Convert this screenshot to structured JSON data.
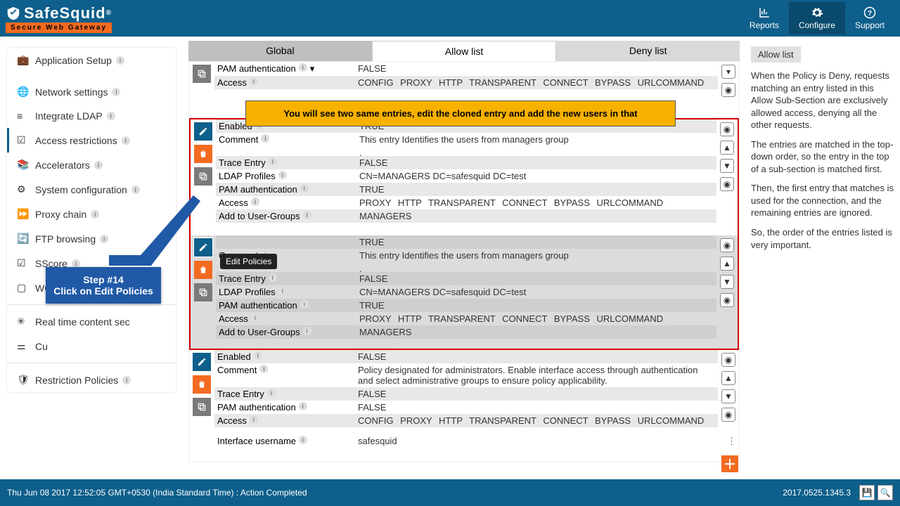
{
  "brand": {
    "name": "SafeSquid",
    "reg": "®",
    "tagline": "Secure Web Gateway"
  },
  "topbar": {
    "reports": "Reports",
    "configure": "Configure",
    "support": "Support"
  },
  "sidebar": {
    "items": [
      {
        "label": "Application Setup",
        "icon": "briefcase"
      },
      {
        "label": "Network settings",
        "icon": "globe"
      },
      {
        "label": "Integrate LDAP",
        "icon": "list"
      },
      {
        "label": "Access restrictions",
        "icon": "check-square",
        "selected": true
      },
      {
        "label": "Accelerators",
        "icon": "layers"
      },
      {
        "label": "System configuration",
        "icon": "gear"
      },
      {
        "label": "Proxy chain",
        "icon": "forward"
      },
      {
        "label": "FTP browsing",
        "icon": "refresh"
      },
      {
        "label": "SScore",
        "icon": "check-square"
      },
      {
        "label": "WCCP",
        "icon": "square"
      }
    ],
    "items2": [
      {
        "label": "Real time content sec",
        "icon": "asterisk"
      },
      {
        "label": "Cu",
        "icon": "sliders"
      }
    ],
    "items3": [
      {
        "label": "Restriction Policies",
        "icon": "shield"
      }
    ]
  },
  "tabs": {
    "global": "Global",
    "allow": "Allow list",
    "deny": "Deny list"
  },
  "callout_yellow": "You will see two same entries, edit the cloned entry and add the new users in that",
  "step_box": {
    "line1": "Step #14",
    "line2": "Click on Edit Policies"
  },
  "tooltip": "Edit Policies",
  "labels": {
    "enabled": "Enabled",
    "comment": "Comment",
    "trace": "Trace Entry",
    "ldap": "LDAP Profiles",
    "pam": "PAM authentication",
    "access": "Access",
    "addug": "Add to User-Groups",
    "ifuser": "Interface username"
  },
  "entry0": {
    "pam": "FALSE",
    "access": "CONFIG  PROXY  HTTP  TRANSPARENT  CONNECT  BYPASS  URLCOMMAND"
  },
  "entry1": {
    "enabled": "TRUE",
    "comment": "This entry Identifies the users from managers group",
    "trace": "FALSE",
    "ldap": "CN=MANAGERS DC=safesquid DC=test",
    "pam": "TRUE",
    "access": "PROXY  HTTP  TRANSPARENT  CONNECT  BYPASS  URLCOMMAND",
    "addug": "MANAGERS"
  },
  "entry2": {
    "enabled": "TRUE",
    "comment": "This entry Identifies the users from managers group",
    "trace": "FALSE",
    "ldap": "CN=MANAGERS DC=safesquid DC=test",
    "pam": "TRUE",
    "access": "PROXY  HTTP  TRANSPARENT  CONNECT  BYPASS  URLCOMMAND",
    "addug": "MANAGERS"
  },
  "entry3": {
    "enabled": "FALSE",
    "comment": "Policy designated for administrators. Enable interface access through authentication and select administrative groups to ensure policy applicability.",
    "trace": "FALSE",
    "pam": "FALSE",
    "access": "CONFIG  PROXY  HTTP  TRANSPARENT  CONNECT  BYPASS  URLCOMMAND",
    "ifuser": "safesquid"
  },
  "rightpanel": {
    "title": "Allow list",
    "p1": "When the Policy is Deny, requests matching an entry listed in this Allow Sub-Section are exclusively allowed access, denying all the other requests.",
    "p2": "The entries are matched in the top-down order, so the entry in the top of a sub-section is matched first.",
    "p3": "Then, the first entry that matches is used for the connection, and the remaining entries are ignored.",
    "p4": "So, the order of the entries listed is very important."
  },
  "footer": {
    "status": "Thu Jun 08 2017 12:52:05 GMT+0530 (India Standard Time) : Action Completed",
    "version": "2017.0525.1345.3"
  }
}
